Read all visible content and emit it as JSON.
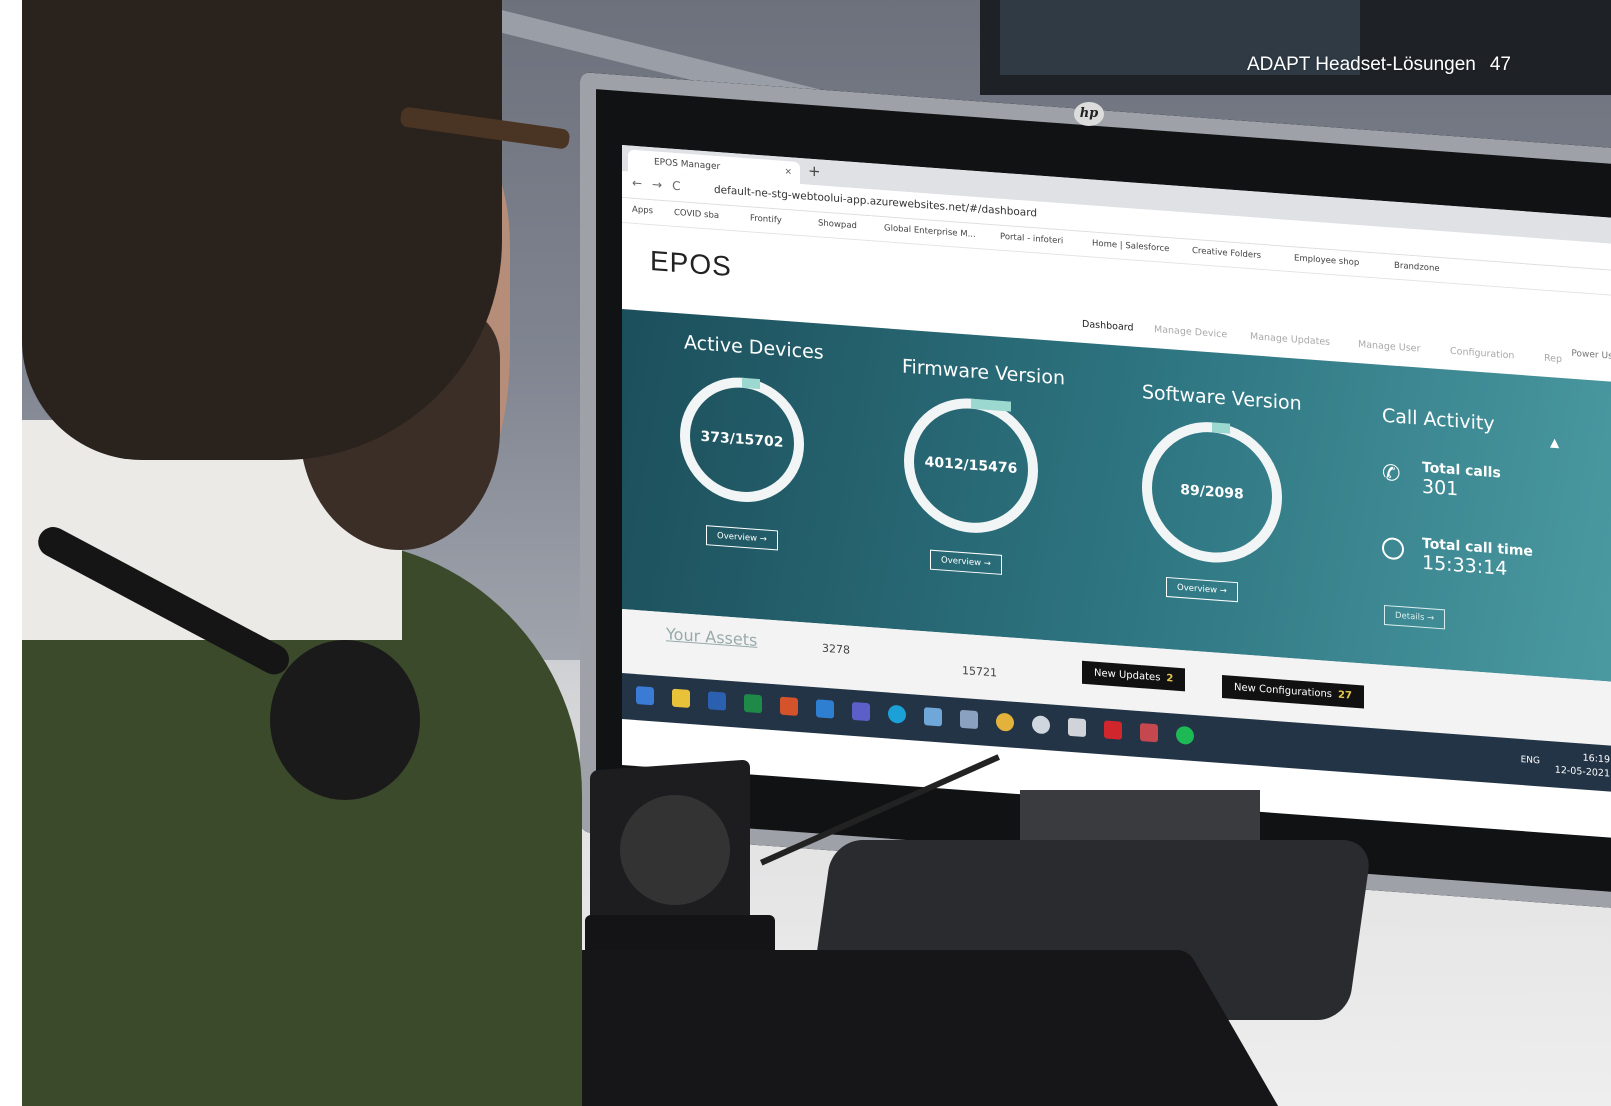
{
  "page_header": {
    "title": "ADAPT Headset-Lösungen",
    "page_number": "47"
  },
  "monitor": {
    "brand_logo": "hp"
  },
  "browser": {
    "tab_title": "EPOS Manager",
    "tab_close": "×",
    "new_tab": "+",
    "nav_glyphs": "←→C",
    "url": "default-ne-stg-webtoolui-app.azurewebsites.net/#/dashboard",
    "bookmarks": [
      "Apps",
      "COVID sba",
      "Frontify",
      "Showpad",
      "Global Enterprise M...",
      "Portal - infoteri",
      "Home | Salesforce",
      "Creative Folders",
      "Employee shop",
      "Brandzone"
    ]
  },
  "app": {
    "logo": "EPOS",
    "menu": [
      "Dashboard",
      "Manage Device",
      "Manage Updates",
      "Manage User",
      "Configuration",
      "Rep"
    ],
    "active_menu": "Dashboard",
    "user": "Power User"
  },
  "dashboard": {
    "active_devices": {
      "title": "Active Devices",
      "value": "373/15702",
      "button": "Overview →"
    },
    "firmware_version": {
      "title": "Firmware Version",
      "value": "4012/15476",
      "button": "Overview →"
    },
    "software_version": {
      "title": "Software Version",
      "value": "89/2098",
      "button": "Overview →"
    },
    "call_activity": {
      "title": "Call Activity",
      "total_calls_label": "Total calls",
      "total_calls_value": "301",
      "total_call_time_label": "Total call time",
      "total_call_time_value": "15:33:14",
      "button": "Details →"
    }
  },
  "assets": {
    "title": "Your Assets",
    "devices_in_stock": "3278",
    "total_devices": "15721",
    "new_updates_label": "New Updates",
    "new_updates_count": "2",
    "new_configurations_label": "New Configurations",
    "new_configurations_count": "27"
  },
  "taskbar": {
    "language": "ENG",
    "time": "16:19",
    "date": "12-05-2021"
  },
  "colors": {
    "dashboard_teal": "#2d7480",
    "ring": "#f2f5f5",
    "accent_ring": "#9bd8d0",
    "taskbar": "#233446"
  }
}
